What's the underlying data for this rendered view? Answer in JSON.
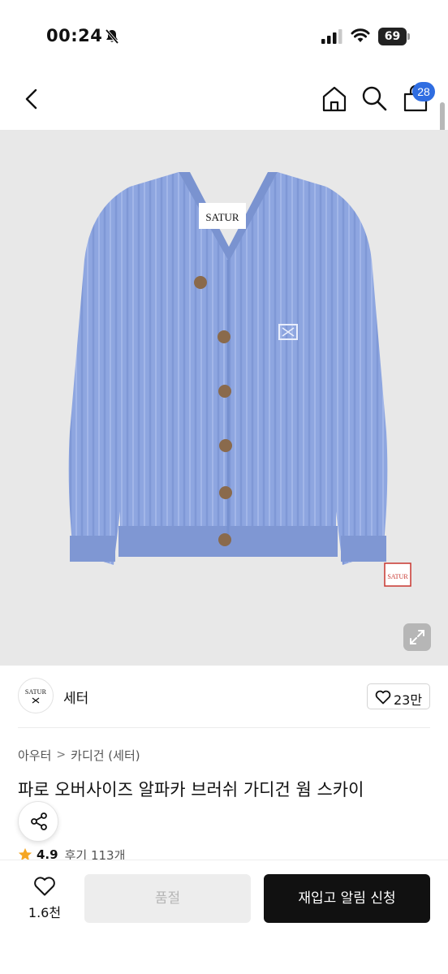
{
  "status_bar": {
    "time": "00:24",
    "battery": "69"
  },
  "nav": {
    "cart_count": "28"
  },
  "product_image": {
    "label_text": "SATUR",
    "cuff_label_text": "SATUR"
  },
  "brand": {
    "logo_text": "SATUR",
    "name": "세터",
    "likes": "23만"
  },
  "breadcrumb": {
    "items": [
      "아우터",
      "카디건 (세터)"
    ],
    "separator": ">"
  },
  "product": {
    "title": "파로 오버사이즈 알파카 브러쉬 가디건 웜 스카이"
  },
  "rating": {
    "value": "4.9",
    "review_label": "후기 113개"
  },
  "bottom_bar": {
    "wish_count": "1.6천",
    "soldout_label": "품절",
    "restock_label": "재입고 알림 신청"
  },
  "colors": {
    "accent_badge": "#2f6de1",
    "sweater": "#8ea6e0",
    "star": "#f5a623"
  }
}
